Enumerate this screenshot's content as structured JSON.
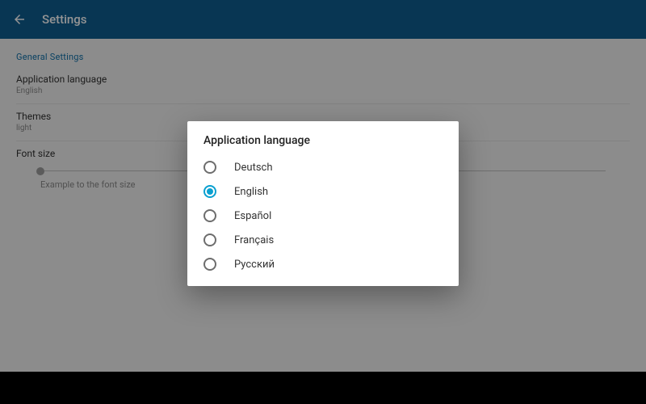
{
  "appbar": {
    "title": "Settings"
  },
  "section": {
    "label": "General Settings"
  },
  "settings": {
    "language": {
      "title": "Application language",
      "value": "English"
    },
    "themes": {
      "title": "Themes",
      "value": "light"
    },
    "fontsize": {
      "title": "Font size",
      "example": "Example to the font size"
    }
  },
  "dialog": {
    "title": "Application language",
    "options": [
      {
        "label": "Deutsch",
        "selected": false
      },
      {
        "label": "English",
        "selected": true
      },
      {
        "label": "Español",
        "selected": false
      },
      {
        "label": "Français",
        "selected": false
      },
      {
        "label": "Русский",
        "selected": false
      }
    ]
  }
}
